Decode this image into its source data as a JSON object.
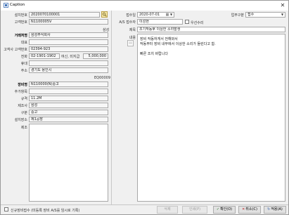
{
  "window": {
    "title": "Caption"
  },
  "left": {
    "equip_no_label": "설치번호",
    "equip_no": "2020070100001",
    "customer_no_label": "고객번호",
    "customer_no": "N1100005V",
    "corner_tag": "삼성",
    "client_label": "거래처명",
    "client_name": "삼성주식회사",
    "rep_label": "대표",
    "rep_value": "",
    "phone_label": "고객사 고객번호",
    "phone_value": "02394-923",
    "contact_label": "전화",
    "contact_value": "02-1901-1902",
    "limit_label": "여신, 미지급",
    "limit_value": "5,000,000",
    "mobile_label": "휴대",
    "mobile_value": "",
    "address_label": "주소",
    "address_value": "경기도 용인시",
    "serial_tag": "EQ00009",
    "model_label": "장비명",
    "model_value": "N110000(N)중고",
    "item_label": "추가항목",
    "item_value": "",
    "size_label": "규격",
    "size_value": "11.2M",
    "maker_label": "제조사",
    "maker_value": "삼성",
    "category_label": "구분",
    "category_value": "중고",
    "location_label": "설치장소",
    "location_value": "제1공장",
    "memo_label": "제조"
  },
  "right": {
    "date_label": "접수일",
    "date_value": "2020-07-01",
    "type_label": "업무구분",
    "type_value": "접수",
    "receiver_label": "A/S 접수자",
    "receiver_value": "이성현",
    "urgent_label": "우선수리",
    "subject_label": "제목",
    "subject_value": "조기작동후 이상한 소리발생",
    "content_label": "내용",
    "content_lines": [
      "장비 작동하게서 전해와서",
      "작동부터 장비 내부에서 이상한 소리가 들린다고 함.",
      "",
      "빠른 조치 바랍니다"
    ]
  },
  "footer": {
    "checkbox_label": "신규장비접수 (미등록 장비 A/S를 임시로 기록)",
    "delete_label": "삭제",
    "history_label": "인쇄(P)",
    "ok_label": "확인(O)",
    "cancel_label": "취소(C)",
    "apply_label": "적용(A)"
  }
}
